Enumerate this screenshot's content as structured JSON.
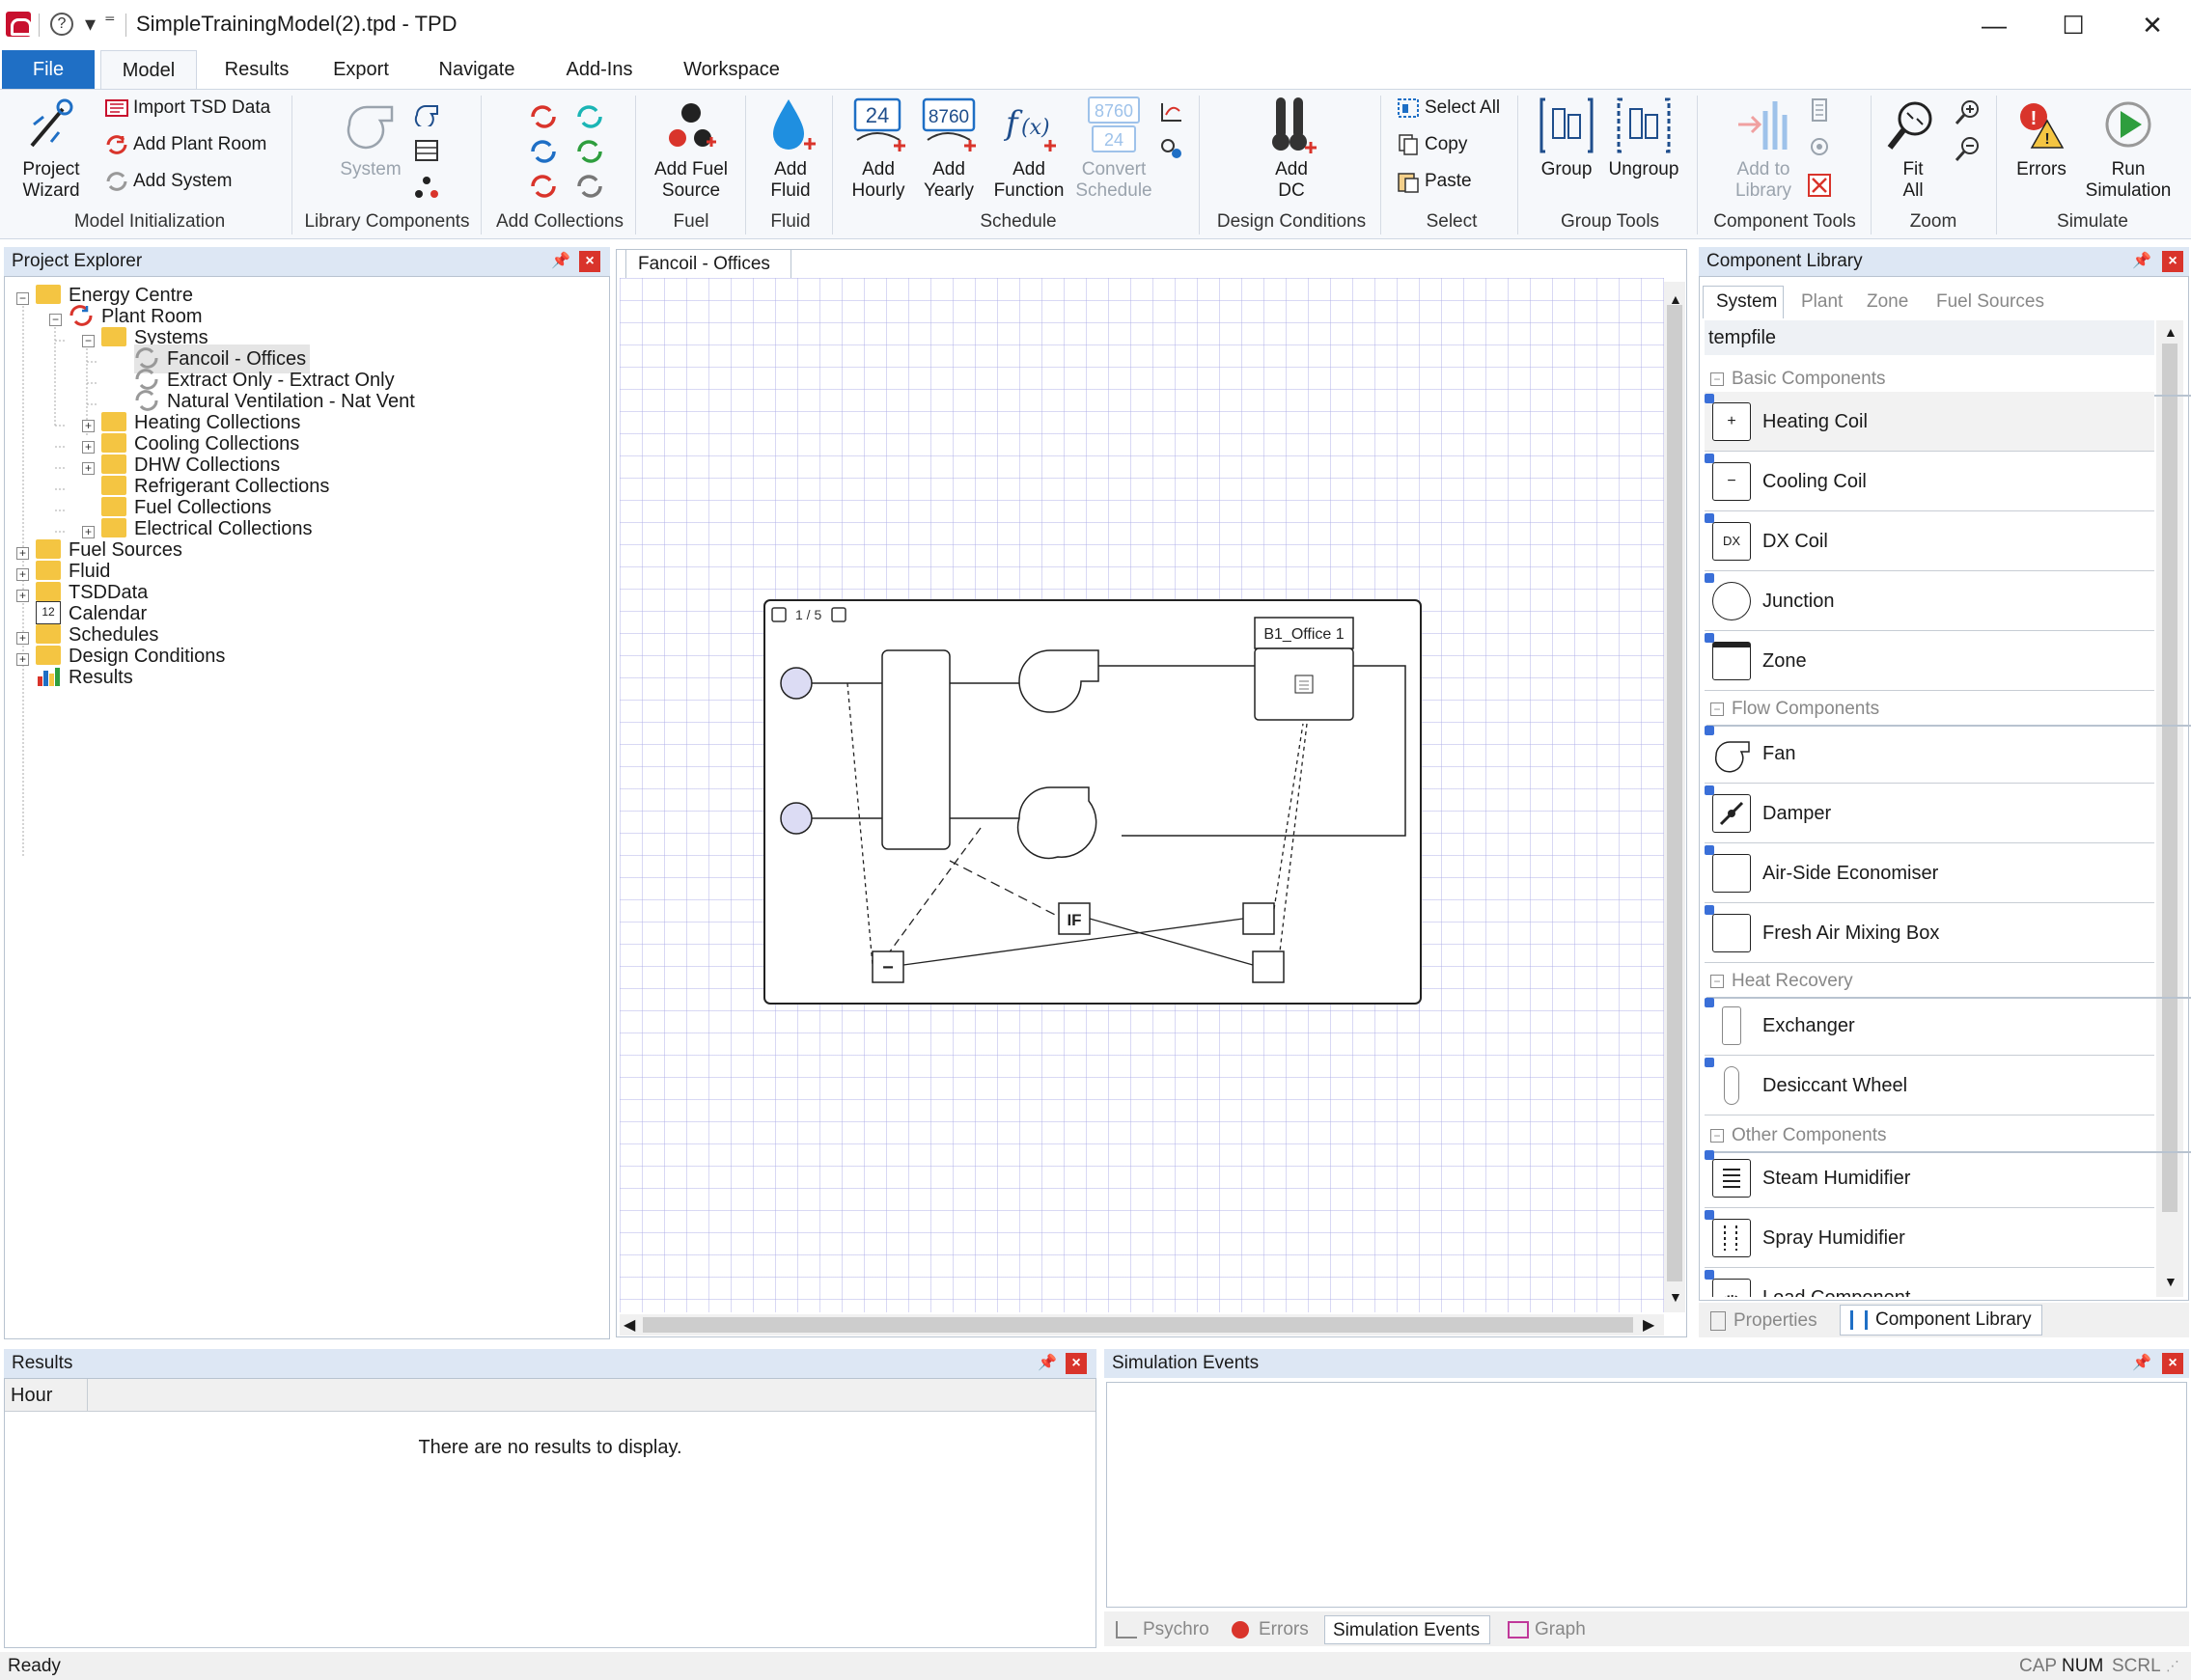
{
  "window": {
    "title": "SimpleTrainingModel(2).tpd - TPD",
    "controls": {
      "minimize": "—",
      "maximize": "☐",
      "close": "✕"
    }
  },
  "qat": {
    "help": "?",
    "dropdown": "▾",
    "customize": "⁼"
  },
  "ribbon": {
    "tabs": [
      "File",
      "Model",
      "Results",
      "Export",
      "Navigate",
      "Add-Ins",
      "Workspace"
    ],
    "groups": {
      "model_initialization": {
        "label": "Model Initialization",
        "project_wizard": "Project\nWizard",
        "import_tsd": "Import TSD Data",
        "add_plant_room": "Add Plant Room",
        "add_system": "Add System"
      },
      "library_components": {
        "label": "Library Components",
        "system": "System"
      },
      "add_collections": {
        "label": "Add Collections"
      },
      "fuel": {
        "label": "Fuel",
        "add_fuel_source": "Add Fuel\nSource"
      },
      "fluid": {
        "label": "Fluid",
        "add_fluid": "Add\nFluid"
      },
      "schedule": {
        "label": "Schedule",
        "add_hourly": "Add\nHourly",
        "add_yearly": "Add\nYearly",
        "add_function": "Add\nFunction",
        "convert_schedule": "Convert\nSchedule"
      },
      "design_conditions": {
        "label": "Design Conditions",
        "add_dc": "Add\nDC"
      },
      "select": {
        "label": "Select",
        "select_all": "Select All",
        "copy": "Copy",
        "paste": "Paste"
      },
      "group_tools": {
        "label": "Group Tools",
        "group": "Group",
        "ungroup": "Ungroup"
      },
      "component_tools": {
        "label": "Component Tools",
        "add_to_library": "Add to\nLibrary"
      },
      "zoom": {
        "label": "Zoom",
        "fit_all": "Fit\nAll"
      },
      "simulate": {
        "label": "Simulate",
        "errors": "Errors",
        "run_simulation": "Run\nSimulation"
      }
    }
  },
  "project_explorer": {
    "title": "Project Explorer",
    "tree": [
      {
        "label": "Energy Centre"
      },
      {
        "label": "Plant Room"
      },
      {
        "label": "Systems"
      },
      {
        "label": "Fancoil - Offices"
      },
      {
        "label": "Extract Only - Extract Only"
      },
      {
        "label": "Natural Ventilation - Nat Vent"
      },
      {
        "label": "Heating Collections"
      },
      {
        "label": "Cooling Collections"
      },
      {
        "label": "DHW Collections"
      },
      {
        "label": "Refrigerant Collections"
      },
      {
        "label": "Fuel Collections"
      },
      {
        "label": "Electrical Collections"
      },
      {
        "label": "Fuel Sources"
      },
      {
        "label": "Fluid"
      },
      {
        "label": "TSDData"
      },
      {
        "label": "Calendar"
      },
      {
        "label": "Schedules"
      },
      {
        "label": "Design Conditions"
      },
      {
        "label": "Results"
      }
    ],
    "calendar_icon_day": "12"
  },
  "document": {
    "tab_title": "Fancoil - Offices",
    "diagram": {
      "page_indicator": "1 / 5",
      "zone_label": "B1_Office 1",
      "controller_label": "IF",
      "minus_label": "−"
    }
  },
  "component_library": {
    "title": "Component Library",
    "tabs": [
      "System",
      "Plant",
      "Zone",
      "Fuel Sources"
    ],
    "file": "tempfile",
    "categories": [
      "Basic Components",
      "Flow Components",
      "Heat Recovery",
      "Other Components"
    ],
    "items": {
      "basic": [
        {
          "label": "Heating Coil",
          "glyph": "+"
        },
        {
          "label": "Cooling Coil",
          "glyph": "−"
        },
        {
          "label": "DX Coil",
          "glyph": "DX"
        },
        {
          "label": "Junction",
          "glyph": ""
        },
        {
          "label": "Zone",
          "glyph": ""
        }
      ],
      "flow": [
        {
          "label": "Fan",
          "glyph": ""
        },
        {
          "label": "Damper",
          "glyph": ""
        },
        {
          "label": "Air-Side Economiser",
          "glyph": ""
        },
        {
          "label": "Fresh Air Mixing Box",
          "glyph": ""
        }
      ],
      "heat_recovery": [
        {
          "label": "Exchanger",
          "glyph": ""
        },
        {
          "label": "Desiccant Wheel",
          "glyph": ""
        }
      ],
      "other": [
        {
          "label": "Steam Humidifier",
          "glyph": ""
        },
        {
          "label": "Spray Humidifier",
          "glyph": ""
        },
        {
          "label": "Load Component",
          "glyph": ""
        }
      ]
    },
    "bottom_tabs": [
      "Properties",
      "Component Library"
    ]
  },
  "results_panel": {
    "title": "Results",
    "column": "Hour",
    "empty_message": "There are no results to display."
  },
  "simulation_events": {
    "title": "Simulation Events",
    "tabs": [
      "Psychro",
      "Errors",
      "Simulation Events",
      "Graph"
    ]
  },
  "status": {
    "text": "Ready",
    "indicators": [
      "CAP",
      "NUM",
      "SCRL"
    ]
  },
  "colors": {
    "file_tab": "#1f6fc5",
    "accent_blue": "#1f6fc5",
    "close_red": "#d9342b",
    "folder": "#f4c542"
  }
}
